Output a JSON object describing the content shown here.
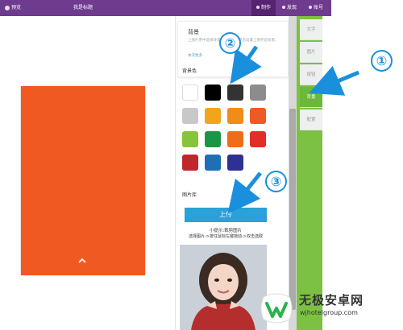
{
  "topbar": {
    "preview_label": "预览",
    "page_title": "我是标题",
    "make_label": "制作",
    "publish_label": "发现",
    "account_label": "账号"
  },
  "panel": {
    "help": {
      "title": "背景",
      "description": "上图片用中选择背景模板，然后单击设置上保存前背景。",
      "link": "本次更多"
    },
    "bg_color_label": "背景色",
    "swatches": [
      "#ffffff",
      "#000000",
      "#333333",
      "#8c8c8c",
      "#c8c8c8",
      "#f2a51c",
      "#f08c18",
      "#ef5a24",
      "#87c43a",
      "#1a9646",
      "#f06c1a",
      "#e32d28",
      "#c0272d",
      "#1f6fb5",
      "#2f3192"
    ],
    "image_library_label": "图片库",
    "upload_label": "上传",
    "hint_line1": "小提示:裁剪图片",
    "hint_line2": "选择图片->按住鼠标左键拖动->双击选取"
  },
  "sidebar": {
    "tabs": [
      {
        "label": "文字",
        "active": false
      },
      {
        "label": "图片",
        "active": false
      },
      {
        "label": "按钮",
        "active": false
      },
      {
        "label": "背景",
        "active": true
      },
      {
        "label": "配置",
        "active": false
      }
    ]
  },
  "callouts": [
    "①",
    "②",
    "③"
  ],
  "watermark": {
    "title": "无极安卓网",
    "url": "wjhotelgroup.com"
  },
  "colors": {
    "topbar": "#6e3b8f",
    "canvas": "#f05a22",
    "sidebar": "#7cc143",
    "upload": "#2aa1d8",
    "callout": "#1a8fdc"
  }
}
